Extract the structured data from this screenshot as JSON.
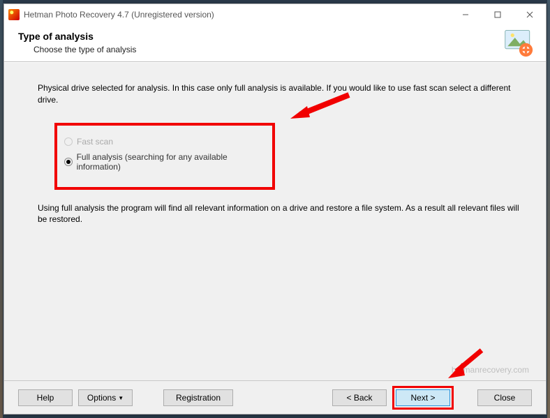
{
  "window": {
    "title": "Hetman Photo Recovery 4.7 (Unregistered version)"
  },
  "header": {
    "title": "Type of analysis",
    "subtitle": "Choose the type of analysis"
  },
  "content": {
    "instruction": "Physical drive selected for analysis. In this case only full analysis is available. If you would like to use fast scan select a different drive.",
    "options": {
      "fast": "Fast scan",
      "full": "Full analysis (searching for any available information)"
    },
    "note": "Using full analysis the program will find all relevant information on a drive and restore a file system. As a result all relevant files will be restored."
  },
  "footer": {
    "help": "Help",
    "options": "Options",
    "registration": "Registration",
    "back": "< Back",
    "next": "Next >",
    "close": "Close"
  },
  "watermark": "hetmanrecovery.com"
}
